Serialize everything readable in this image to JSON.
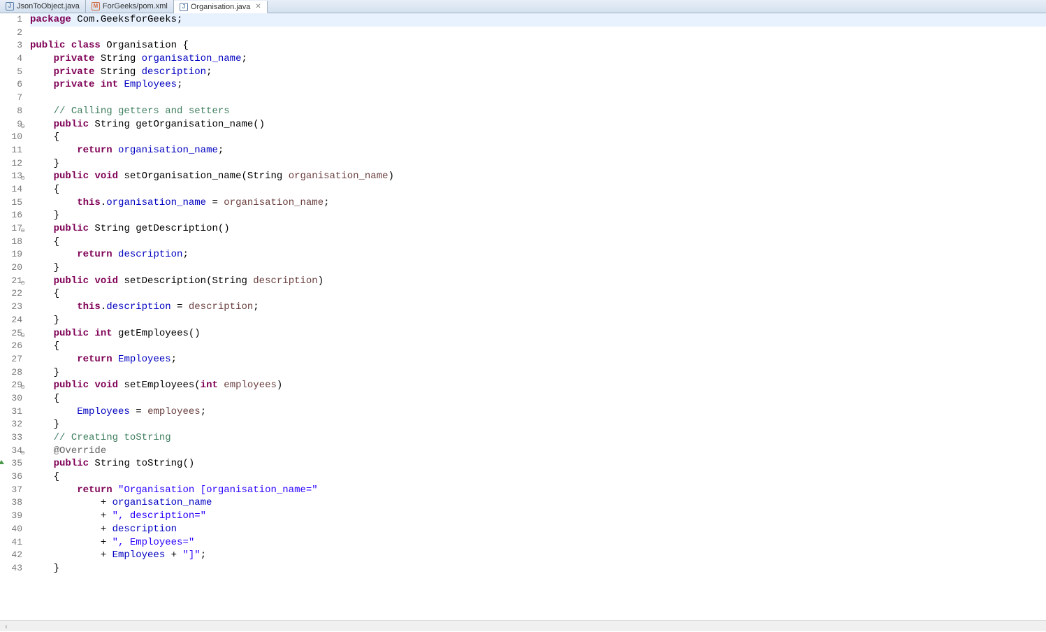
{
  "tabs": [
    {
      "label": "JsonToObject.java",
      "icon": "J",
      "iconColor": "#5b7ea8",
      "active": false
    },
    {
      "label": "ForGeeks/pom.xml",
      "icon": "M",
      "iconColor": "#d06a3f",
      "active": false
    },
    {
      "label": "Organisation.java",
      "icon": "J",
      "iconColor": "#5b7ea8",
      "active": true
    }
  ],
  "code_lines": [
    {
      "n": 1,
      "marker": "",
      "highlight": true,
      "tokens": [
        [
          "kw",
          "package"
        ],
        [
          "",
          " Com.GeeksforGeeks;"
        ]
      ]
    },
    {
      "n": 2,
      "marker": "",
      "tokens": [
        [
          "",
          ""
        ]
      ]
    },
    {
      "n": 3,
      "marker": "",
      "tokens": [
        [
          "kw",
          "public"
        ],
        [
          "",
          " "
        ],
        [
          "kw",
          "class"
        ],
        [
          "",
          " Organisation {"
        ]
      ]
    },
    {
      "n": 4,
      "marker": "",
      "tokens": [
        [
          "",
          "    "
        ],
        [
          "kw",
          "private"
        ],
        [
          "",
          " String "
        ],
        [
          "fld",
          "organisation_name"
        ],
        [
          "",
          ";"
        ]
      ]
    },
    {
      "n": 5,
      "marker": "",
      "tokens": [
        [
          "",
          "    "
        ],
        [
          "kw",
          "private"
        ],
        [
          "",
          " String "
        ],
        [
          "fld",
          "description"
        ],
        [
          "",
          ";"
        ]
      ]
    },
    {
      "n": 6,
      "marker": "",
      "tokens": [
        [
          "",
          "    "
        ],
        [
          "kw",
          "private"
        ],
        [
          "",
          " "
        ],
        [
          "kw",
          "int"
        ],
        [
          "",
          " "
        ],
        [
          "fld",
          "Employees"
        ],
        [
          "",
          ";"
        ]
      ]
    },
    {
      "n": 7,
      "marker": "",
      "tokens": [
        [
          "",
          ""
        ]
      ]
    },
    {
      "n": 8,
      "marker": "",
      "tokens": [
        [
          "",
          "    "
        ],
        [
          "cmt",
          "// Calling getters and setters"
        ]
      ]
    },
    {
      "n": 9,
      "marker": "fold",
      "tokens": [
        [
          "",
          "    "
        ],
        [
          "kw",
          "public"
        ],
        [
          "",
          " String getOrganisation_name()"
        ]
      ]
    },
    {
      "n": 10,
      "marker": "",
      "tokens": [
        [
          "",
          "    {"
        ]
      ]
    },
    {
      "n": 11,
      "marker": "",
      "tokens": [
        [
          "",
          "        "
        ],
        [
          "kw",
          "return"
        ],
        [
          "",
          " "
        ],
        [
          "fld",
          "organisation_name"
        ],
        [
          "",
          ";"
        ]
      ]
    },
    {
      "n": 12,
      "marker": "",
      "tokens": [
        [
          "",
          "    }"
        ]
      ]
    },
    {
      "n": 13,
      "marker": "fold",
      "tokens": [
        [
          "",
          "    "
        ],
        [
          "kw",
          "public"
        ],
        [
          "",
          " "
        ],
        [
          "kw",
          "void"
        ],
        [
          "",
          " setOrganisation_name(String "
        ],
        [
          "param",
          "organisation_name"
        ],
        [
          "",
          ")"
        ]
      ]
    },
    {
      "n": 14,
      "marker": "",
      "tokens": [
        [
          "",
          "    {"
        ]
      ]
    },
    {
      "n": 15,
      "marker": "",
      "tokens": [
        [
          "",
          "        "
        ],
        [
          "kw",
          "this"
        ],
        [
          "",
          "."
        ],
        [
          "fld",
          "organisation_name"
        ],
        [
          "",
          " = "
        ],
        [
          "param",
          "organisation_name"
        ],
        [
          "",
          ";"
        ]
      ]
    },
    {
      "n": 16,
      "marker": "",
      "tokens": [
        [
          "",
          "    }"
        ]
      ]
    },
    {
      "n": 17,
      "marker": "fold",
      "tokens": [
        [
          "",
          "    "
        ],
        [
          "kw",
          "public"
        ],
        [
          "",
          " String getDescription()"
        ]
      ]
    },
    {
      "n": 18,
      "marker": "",
      "tokens": [
        [
          "",
          "    {"
        ]
      ]
    },
    {
      "n": 19,
      "marker": "",
      "tokens": [
        [
          "",
          "        "
        ],
        [
          "kw",
          "return"
        ],
        [
          "",
          " "
        ],
        [
          "fld",
          "description"
        ],
        [
          "",
          ";"
        ]
      ]
    },
    {
      "n": 20,
      "marker": "",
      "tokens": [
        [
          "",
          "    }"
        ]
      ]
    },
    {
      "n": 21,
      "marker": "fold",
      "tokens": [
        [
          "",
          "    "
        ],
        [
          "kw",
          "public"
        ],
        [
          "",
          " "
        ],
        [
          "kw",
          "void"
        ],
        [
          "",
          " setDescription(String "
        ],
        [
          "param",
          "description"
        ],
        [
          "",
          ")"
        ]
      ]
    },
    {
      "n": 22,
      "marker": "",
      "tokens": [
        [
          "",
          "    {"
        ]
      ]
    },
    {
      "n": 23,
      "marker": "",
      "tokens": [
        [
          "",
          "        "
        ],
        [
          "kw",
          "this"
        ],
        [
          "",
          "."
        ],
        [
          "fld",
          "description"
        ],
        [
          "",
          " = "
        ],
        [
          "param",
          "description"
        ],
        [
          "",
          ";"
        ]
      ]
    },
    {
      "n": 24,
      "marker": "",
      "tokens": [
        [
          "",
          "    }"
        ]
      ]
    },
    {
      "n": 25,
      "marker": "fold",
      "tokens": [
        [
          "",
          "    "
        ],
        [
          "kw",
          "public"
        ],
        [
          "",
          " "
        ],
        [
          "kw",
          "int"
        ],
        [
          "",
          " getEmployees()"
        ]
      ]
    },
    {
      "n": 26,
      "marker": "",
      "tokens": [
        [
          "",
          "    {"
        ]
      ]
    },
    {
      "n": 27,
      "marker": "",
      "tokens": [
        [
          "",
          "        "
        ],
        [
          "kw",
          "return"
        ],
        [
          "",
          " "
        ],
        [
          "fld",
          "Employees"
        ],
        [
          "",
          ";"
        ]
      ]
    },
    {
      "n": 28,
      "marker": "",
      "tokens": [
        [
          "",
          "    }"
        ]
      ]
    },
    {
      "n": 29,
      "marker": "fold",
      "tokens": [
        [
          "",
          "    "
        ],
        [
          "kw",
          "public"
        ],
        [
          "",
          " "
        ],
        [
          "kw",
          "void"
        ],
        [
          "",
          " setEmployees("
        ],
        [
          "kw",
          "int"
        ],
        [
          "",
          " "
        ],
        [
          "param",
          "employees"
        ],
        [
          "",
          ")"
        ]
      ]
    },
    {
      "n": 30,
      "marker": "",
      "tokens": [
        [
          "",
          "    {"
        ]
      ]
    },
    {
      "n": 31,
      "marker": "",
      "tokens": [
        [
          "",
          "        "
        ],
        [
          "fld",
          "Employees"
        ],
        [
          "",
          " = "
        ],
        [
          "param",
          "employees"
        ],
        [
          "",
          ";"
        ]
      ]
    },
    {
      "n": 32,
      "marker": "",
      "tokens": [
        [
          "",
          "    }"
        ]
      ]
    },
    {
      "n": 33,
      "marker": "",
      "tokens": [
        [
          "",
          "    "
        ],
        [
          "cmt",
          "// Creating toString"
        ]
      ]
    },
    {
      "n": 34,
      "marker": "fold",
      "tokens": [
        [
          "",
          "    "
        ],
        [
          "ann",
          "@Override"
        ]
      ]
    },
    {
      "n": 35,
      "marker": "override",
      "tokens": [
        [
          "",
          "    "
        ],
        [
          "kw",
          "public"
        ],
        [
          "",
          " String toString()"
        ]
      ]
    },
    {
      "n": 36,
      "marker": "",
      "tokens": [
        [
          "",
          "    {"
        ]
      ]
    },
    {
      "n": 37,
      "marker": "",
      "tokens": [
        [
          "",
          "        "
        ],
        [
          "kw",
          "return"
        ],
        [
          "",
          " "
        ],
        [
          "str",
          "\"Organisation [organisation_name=\""
        ]
      ]
    },
    {
      "n": 38,
      "marker": "",
      "tokens": [
        [
          "",
          "            + "
        ],
        [
          "fld",
          "organisation_name"
        ]
      ]
    },
    {
      "n": 39,
      "marker": "",
      "tokens": [
        [
          "",
          "            + "
        ],
        [
          "str",
          "\", description=\""
        ]
      ]
    },
    {
      "n": 40,
      "marker": "",
      "tokens": [
        [
          "",
          "            + "
        ],
        [
          "fld",
          "description"
        ]
      ]
    },
    {
      "n": 41,
      "marker": "",
      "tokens": [
        [
          "",
          "            + "
        ],
        [
          "str",
          "\", Employees=\""
        ]
      ]
    },
    {
      "n": 42,
      "marker": "",
      "tokens": [
        [
          "",
          "            + "
        ],
        [
          "fld",
          "Employees"
        ],
        [
          "",
          " + "
        ],
        [
          "str",
          "\"]\""
        ],
        [
          "",
          ";"
        ]
      ]
    },
    {
      "n": 43,
      "marker": "",
      "tokens": [
        [
          "",
          "    }"
        ]
      ]
    }
  ]
}
